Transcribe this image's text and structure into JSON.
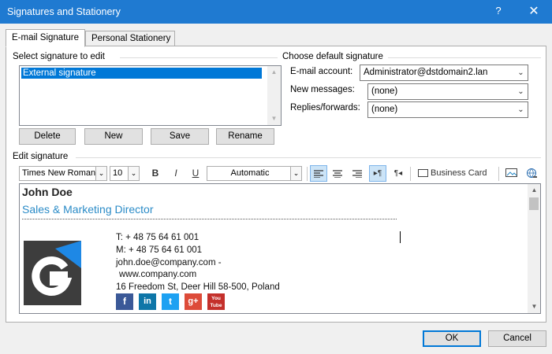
{
  "window": {
    "title": "Signatures and Stationery",
    "help_label": "?",
    "close_label": "✕"
  },
  "tabs": [
    {
      "label": "E-mail Signature",
      "active": true
    },
    {
      "label": "Personal Stationery",
      "active": false
    }
  ],
  "select_section": {
    "label": "Select signature to edit",
    "items": [
      "External signature"
    ],
    "buttons": {
      "delete": "Delete",
      "new": "New",
      "save": "Save",
      "rename": "Rename"
    }
  },
  "default_section": {
    "label": "Choose default signature",
    "email_account_label": "E-mail account:",
    "email_account_value": "Administrator@dstdomain2.lan",
    "new_messages_label": "New messages:",
    "new_messages_value": "(none)",
    "replies_label": "Replies/forwards:",
    "replies_value": "(none)"
  },
  "edit_section": {
    "label": "Edit signature",
    "font_name": "Times New Roman",
    "font_size": "10",
    "bold": "B",
    "italic": "I",
    "underline": "U",
    "color": "Automatic",
    "business_card_label": "Business Card"
  },
  "signature": {
    "name": "John Doe",
    "role": "Sales & Marketing Director",
    "phone": "T: + 48 75 64 61 001",
    "mobile": "M: + 48 75 64 61 001",
    "email": "john.doe@company.com -",
    "website": "www.company.com",
    "address": "16 Freedom St, Deer Hill 58-500, Poland",
    "social": [
      {
        "icon": "facebook-icon",
        "glyph": "f",
        "color": "#3b5998"
      },
      {
        "icon": "linkedin-icon",
        "glyph": "in",
        "color": "#0e76a8"
      },
      {
        "icon": "twitter-icon",
        "glyph": "t",
        "color": "#1da1f2"
      },
      {
        "icon": "googleplus-icon",
        "glyph": "g+",
        "color": "#dd4b39"
      },
      {
        "icon": "youtube-icon",
        "glyph": "You Tube",
        "color": "#c4302b"
      }
    ]
  },
  "footer": {
    "ok": "OK",
    "cancel": "Cancel"
  },
  "colors": {
    "accent": "#0078d7",
    "titlebar": "#1f7ad1",
    "role_text": "#2a8bc7",
    "logo_bg": "#3d3d3d",
    "logo_accent": "#1e88e5"
  }
}
